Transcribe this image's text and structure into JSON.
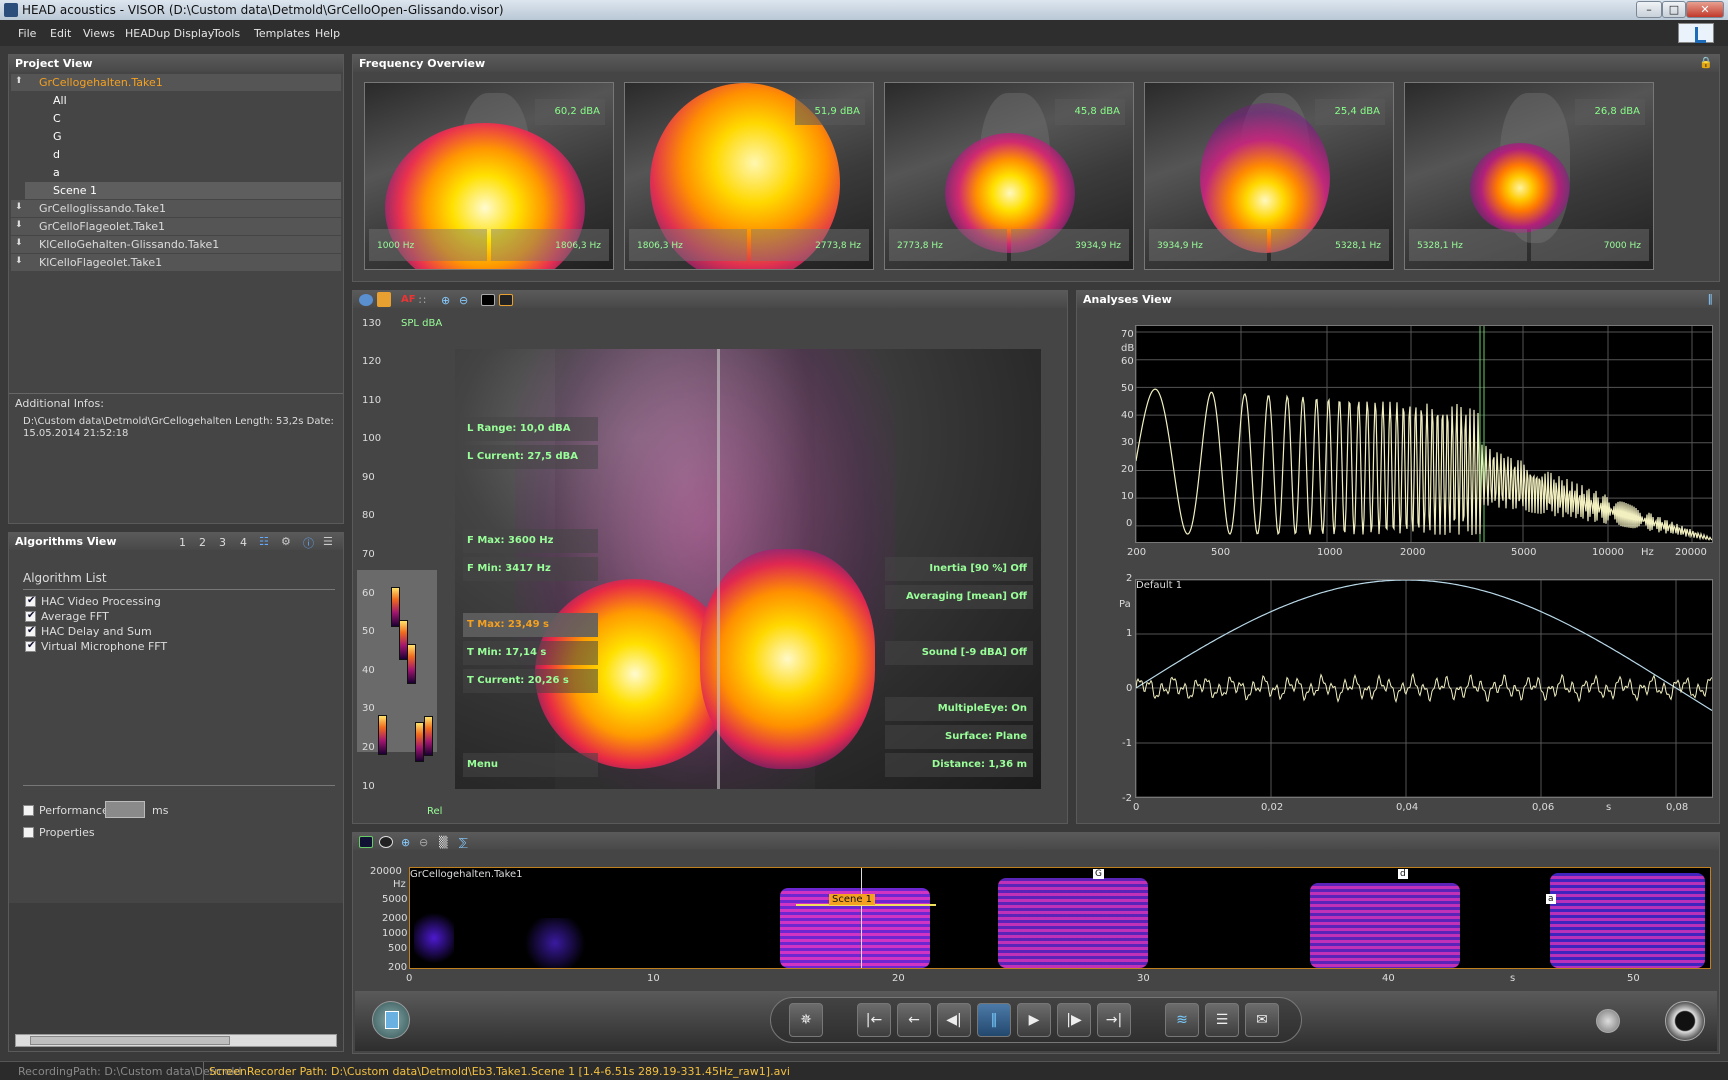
{
  "window": {
    "title": "HEAD acoustics - VISOR  (D:\\Custom data\\Detmold\\GrCelloOpen-Glissando.visor)",
    "minimize": "–",
    "maximize": "□",
    "close": "✕"
  },
  "menu": [
    "File",
    "Edit",
    "Views",
    "HEADup Display",
    "Tools",
    "Templates",
    "Help"
  ],
  "project_view": {
    "title": "Project View",
    "takes": [
      {
        "label": "GrCellogehalten.Take1",
        "expanded": true
      },
      {
        "label": "GrCelloglissando.Take1",
        "expanded": false
      },
      {
        "label": "GrCelloFlageolet.Take1",
        "expanded": false
      },
      {
        "label": "KlCelloGehalten-Glissando.Take1",
        "expanded": false
      },
      {
        "label": "KlCelloFlageolet.Take1",
        "expanded": false
      }
    ],
    "sub_items": [
      "All",
      "C",
      "G",
      "d",
      "a",
      "Scene 1"
    ],
    "info_title": "Additional Infos:",
    "info_line1": "D:\\Custom data\\Detmold\\GrCellogehalten    Length: 53,2s  Date:",
    "info_line2": "15.05.2014 21:52:18"
  },
  "frequency_overview": {
    "title": "Frequency Overview",
    "thumbs": [
      {
        "level": "60,2 dBA",
        "f_lo": "1000 Hz",
        "f_hi": "1806,3 Hz"
      },
      {
        "level": "51,9 dBA",
        "f_lo": "1806,3 Hz",
        "f_hi": "2773,8 Hz"
      },
      {
        "level": "45,8 dBA",
        "f_lo": "2773,8 Hz",
        "f_hi": "3934,9 Hz"
      },
      {
        "level": "25,4 dBA",
        "f_lo": "3934,9 Hz",
        "f_hi": "5328,1 Hz"
      },
      {
        "level": "26,8 dBA",
        "f_lo": "5328,1 Hz",
        "f_hi": "7000 Hz"
      }
    ]
  },
  "video_view": {
    "meter_label": "SPL dBA",
    "meter_ticks": [
      "130",
      "120",
      "110",
      "100",
      "90",
      "80",
      "70",
      "60",
      "50",
      "40",
      "30",
      "20",
      "10"
    ],
    "meter_footer": "Rel",
    "left_overlays": [
      "L Range: 10,0 dBA",
      "L Current: 27,5 dBA",
      "F Max: 3600 Hz",
      "F Min: 3417 Hz",
      "T Max: 23,49 s",
      "T Min: 17,14 s",
      "T Current: 20,26 s",
      "Menu"
    ],
    "right_overlays": [
      "Inertia [90 %] Off",
      "Averaging [mean] Off",
      "Sound [-9 dBA] Off",
      "MultipleEye: On",
      "Surface: Plane",
      "Distance: 1,36 m"
    ]
  },
  "analyses_view": {
    "title": "Analyses View",
    "fft": {
      "y_ticks": [
        "70",
        "60",
        "50",
        "40",
        "30",
        "20",
        "10",
        "0"
      ],
      "y_unit": "dB",
      "x_ticks": [
        "200",
        "500",
        "1000",
        "2000",
        "5000",
        "10000",
        "20000"
      ],
      "x_unit": "Hz"
    },
    "time": {
      "legend": "Default 1",
      "y_ticks": [
        "2",
        "1",
        "0",
        "-1",
        "-2"
      ],
      "y_unit": "Pa",
      "x_ticks": [
        "0",
        "0,02",
        "0,04",
        "0,06",
        "0,08"
      ],
      "x_unit": "s"
    }
  },
  "algorithms_view": {
    "title": "Algorithms View",
    "pages": [
      "1",
      "2",
      "3",
      "4"
    ],
    "list_title": "Algorithm List",
    "items": [
      "HAC Video Processing",
      "Average FFT",
      "HAC Delay and Sum",
      "Virtual Microphone FFT"
    ],
    "performance_label": "Performance",
    "performance_unit": "ms",
    "properties_label": "Properties"
  },
  "timeline": {
    "take_label": "GrCellogehalten.Take1",
    "y_ticks": [
      "20000",
      "5000",
      "2000",
      "1000",
      "500",
      "200"
    ],
    "y_unit": "Hz",
    "x_ticks": [
      "0",
      "10",
      "20",
      "30",
      "40",
      "50"
    ],
    "x_unit": "s",
    "scene_label": "Scene 1",
    "markers": [
      "G",
      "d",
      "a"
    ]
  },
  "status": {
    "recording_path": "RecordingPath:  D:\\Custom data\\Detmold",
    "screen_recorder": "ScreenRecorder Path: D:\\Custom data\\Detmold\\Eb3.Take1.Scene 1 [1.4-6.51s  289.19-331.45Hz_raw1].avi"
  },
  "colors": {
    "accent": "#f4a020",
    "overlay_text": "#99ff99",
    "fft_trace": "#f2f0c0",
    "time_window": "#b8d8e8"
  },
  "icons": [
    "search-icon",
    "gear-icon",
    "help-icon",
    "menu-icon",
    "lock-icon",
    "pin-icon",
    "first-icon",
    "prev-icon",
    "step-back-icon",
    "pause-icon",
    "play-icon",
    "step-forward-icon",
    "last-icon"
  ]
}
